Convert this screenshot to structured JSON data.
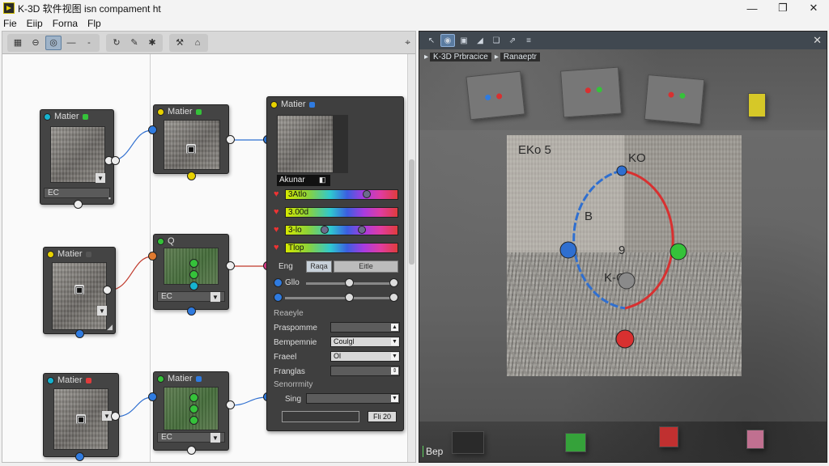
{
  "window": {
    "title": "K-3D 软件视图 isn compament ht",
    "minimize": "—",
    "maximize": "❐",
    "close": "✕"
  },
  "menu": [
    "Fie",
    "Eiip",
    "Forna",
    "Flp"
  ],
  "node_editor": {
    "nodes": [
      {
        "title": "Matier",
        "footer": "EC"
      },
      {
        "title": "Matier",
        "footer": ""
      },
      {
        "title": "Matier",
        "footer": ""
      },
      {
        "title": "Matier",
        "footer": ""
      },
      {
        "title": "Q",
        "footer": "EC"
      },
      {
        "title": "Matier",
        "footer": ""
      },
      {
        "title": "Matier",
        "footer": "EC"
      }
    ],
    "props_panel": {
      "title": "Matier",
      "caption": "Akunar",
      "gradients": [
        "3Atlo",
        "3.00d",
        "3-lo",
        "Tlop"
      ],
      "eng_label": "Eng",
      "eng_seg": [
        "Raqa",
        "Eitle"
      ],
      "slider_label": "Gllo",
      "section_head": "Reaeyle",
      "fields": [
        {
          "label": "Praspomme",
          "value": ""
        },
        {
          "label": "Bempemnie",
          "value": "Coulgl"
        },
        {
          "label": "Fraeel",
          "value": "Ol"
        },
        {
          "label": "Franglas",
          "value": ""
        }
      ],
      "section2": "Senorrmity",
      "sing_label": "Sing",
      "bottom_value": "Fli 20"
    }
  },
  "viewport": {
    "breadcrumb": [
      "K-3D Prbracice",
      "Ranaeptr"
    ],
    "labels": {
      "top_left": "EKo 5",
      "top_right": "KO",
      "left": "B",
      "center": "9",
      "bottom": "K-O"
    },
    "status": "Bep"
  },
  "colors": {
    "accent_blue": "#2f7be0",
    "ring_red": "#d83030",
    "ring_blue": "#2f6fd0",
    "green": "#35c23a"
  }
}
